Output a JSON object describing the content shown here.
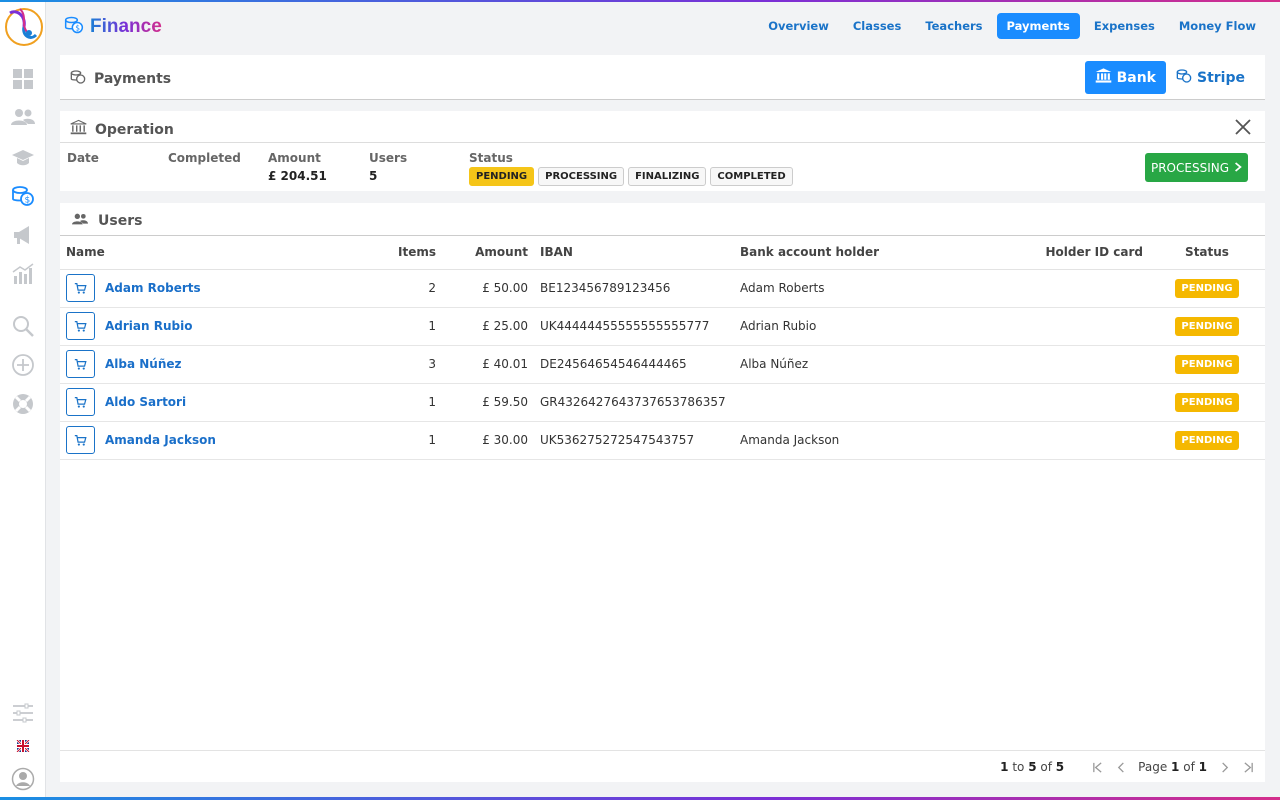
{
  "app": {
    "title": "Finance"
  },
  "topnav": [
    {
      "label": "Overview",
      "active": false
    },
    {
      "label": "Classes",
      "active": false
    },
    {
      "label": "Teachers",
      "active": false
    },
    {
      "label": "Payments",
      "active": true
    },
    {
      "label": "Expenses",
      "active": false
    },
    {
      "label": "Money Flow",
      "active": false
    }
  ],
  "sidebar": {
    "icons": [
      "dashboard-icon",
      "users-icon",
      "graduation-cap-icon",
      "finance-coins-icon",
      "megaphone-icon",
      "chart-icon",
      "search-icon",
      "add-circle-icon",
      "lifebuoy-icon",
      "sliders-icon",
      "uk-flag-icon",
      "user-profile-icon"
    ]
  },
  "payments_panel": {
    "title": "Payments",
    "bank_label": "Bank",
    "stripe_label": "Stripe"
  },
  "operation": {
    "title": "Operation",
    "fields": {
      "date_label": "Date",
      "completed_label": "Completed",
      "amount_label": "Amount",
      "amount_value": "£ 204.51",
      "users_label": "Users",
      "users_value": "5",
      "status_label": "Status"
    },
    "statuses": [
      "PENDING",
      "PROCESSING",
      "FINALIZING",
      "COMPLETED"
    ],
    "active_status": "PENDING",
    "action_label": "PROCESSING"
  },
  "users": {
    "title": "Users",
    "columns": {
      "name": "Name",
      "items": "Items",
      "amount": "Amount",
      "iban": "IBAN",
      "holder": "Bank account holder",
      "id_card": "Holder ID card",
      "status": "Status"
    },
    "rows": [
      {
        "name": "Adam Roberts",
        "items": "2",
        "amount": "£ 50.00",
        "iban": "BE123456789123456",
        "holder": "Adam Roberts",
        "id_card": "",
        "status": "PENDING"
      },
      {
        "name": "Adrian Rubio",
        "items": "1",
        "amount": "£ 25.00",
        "iban": "UK44444455555555555777",
        "holder": "Adrian Rubio",
        "id_card": "",
        "status": "PENDING"
      },
      {
        "name": "Alba Núñez",
        "items": "3",
        "amount": "£ 40.01",
        "iban": "DE24564654546444465",
        "holder": "Alba Núñez",
        "id_card": "",
        "status": "PENDING"
      },
      {
        "name": "Aldo Sartori",
        "items": "1",
        "amount": "£ 59.50",
        "iban": "GR4326427643737653786357",
        "holder": "",
        "id_card": "",
        "status": "PENDING"
      },
      {
        "name": "Amanda Jackson",
        "items": "1",
        "amount": "£ 30.00",
        "iban": "UK536275272547543757",
        "holder": "Amanda Jackson",
        "id_card": "",
        "status": "PENDING"
      }
    ]
  },
  "pagination": {
    "from": "1",
    "to_word": "to",
    "to": "5",
    "of_word": "of",
    "total": "5",
    "page_word": "Page",
    "page": "1",
    "pages": "1"
  },
  "colors": {
    "accent": "#1a8cff",
    "link": "#1a6fc9",
    "pending": "#f5b800",
    "success": "#28a745"
  }
}
